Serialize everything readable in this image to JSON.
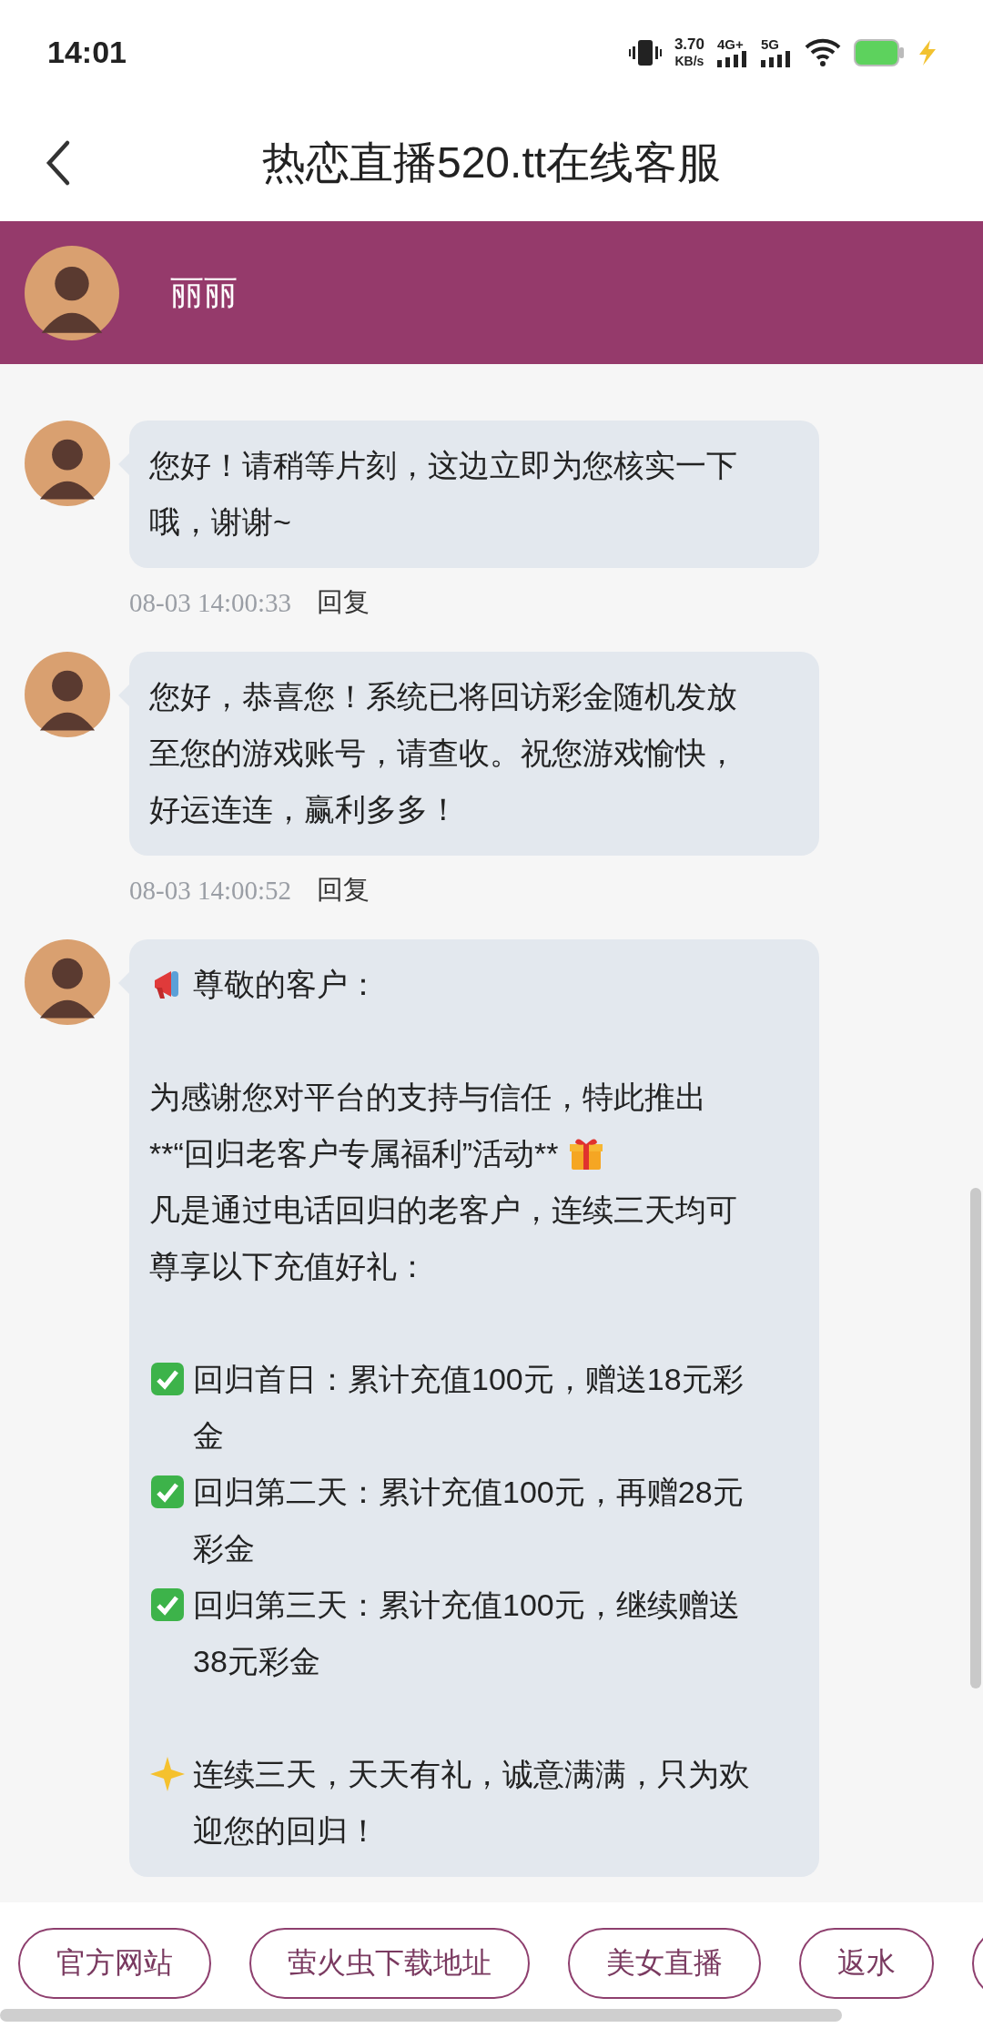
{
  "status_bar": {
    "time": "14:01",
    "speed_value": "3.70",
    "speed_unit": "KB/s",
    "network_1": "4G+",
    "network_2": "5G"
  },
  "header": {
    "title": "热恋直播520.tt在线客服"
  },
  "agent": {
    "name": "丽丽"
  },
  "messages": [
    {
      "paragraphs": [
        {
          "kind": "plain",
          "text": "您好！请稍等片刻，这边立即为您核实一下哦，谢谢~"
        }
      ],
      "time": "08-03 14:00:33",
      "reply": "回复"
    },
    {
      "paragraphs": [
        {
          "kind": "plain",
          "text": "您好，恭喜您！系统已将回访彩金随机发放至您的游戏账号，请查收。祝您游戏愉快，好运连连，赢利多多！"
        }
      ],
      "time": "08-03 14:00:52",
      "reply": "回复"
    },
    {
      "paragraphs": [
        {
          "kind": "announce",
          "text": "尊敬的客户："
        },
        {
          "kind": "blank"
        },
        {
          "kind": "plain",
          "text": "为感谢您对平台的支持与信任，特此推出"
        },
        {
          "kind": "gift",
          "text": "**“回归老客户专属福利”活动**"
        },
        {
          "kind": "plain",
          "text": "凡是通过电话回归的老客户，连续三天均可尊享以下充值好礼："
        },
        {
          "kind": "blank"
        },
        {
          "kind": "check",
          "text": "回归首日：累计充值100元，赠送18元彩金"
        },
        {
          "kind": "check",
          "text": "回归第二天：累计充值100元，再赠28元彩金"
        },
        {
          "kind": "check",
          "text": "回归第三天：累计充值100元，继续赠送38元彩金"
        },
        {
          "kind": "blank"
        },
        {
          "kind": "star",
          "text": "连续三天，天天有礼，诚意满满，只为欢迎您的回归！"
        }
      ]
    }
  ],
  "quick_links": [
    {
      "label": "官方网站"
    },
    {
      "label": "萤火虫下载地址"
    },
    {
      "label": "美女直播"
    },
    {
      "label": "返水"
    }
  ]
}
